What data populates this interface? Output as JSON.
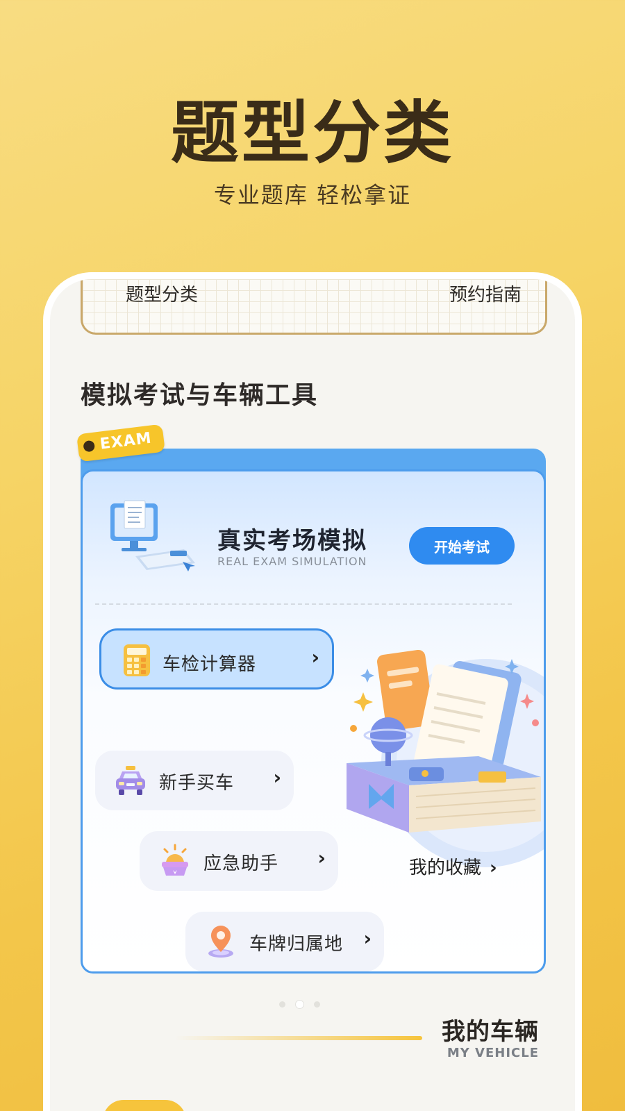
{
  "hero": {
    "title": "题型分类",
    "subtitle": "专业题库 轻松拿证"
  },
  "top_tabs": {
    "left": "题型分类",
    "right": "预约指南"
  },
  "section": {
    "title": "模拟考试与车辆工具"
  },
  "exam_card": {
    "badge": "EXAM",
    "title": "真实考场模拟",
    "subtitle": "REAL EXAM SIMULATION",
    "start_button": "开始考试"
  },
  "tools": [
    {
      "label": "车检计算器",
      "icon": "calculator-icon",
      "chevron": "›"
    },
    {
      "label": "新手买车",
      "icon": "car-icon",
      "chevron": "›"
    },
    {
      "label": "应急助手",
      "icon": "emergency-light-icon",
      "chevron": "›"
    },
    {
      "label": "车牌归属地",
      "icon": "location-pin-icon",
      "chevron": "›"
    }
  ],
  "favorites": {
    "label": "我的收藏",
    "chevron": "›"
  },
  "pager": {
    "count": 3,
    "active_index": 1
  },
  "vehicle": {
    "title": "我的车辆",
    "subtitle": "MY VEHICLE"
  },
  "colors": {
    "accent_blue": "#2f8bf0",
    "accent_yellow": "#f6c43c",
    "dark_text": "#3a2c18"
  }
}
